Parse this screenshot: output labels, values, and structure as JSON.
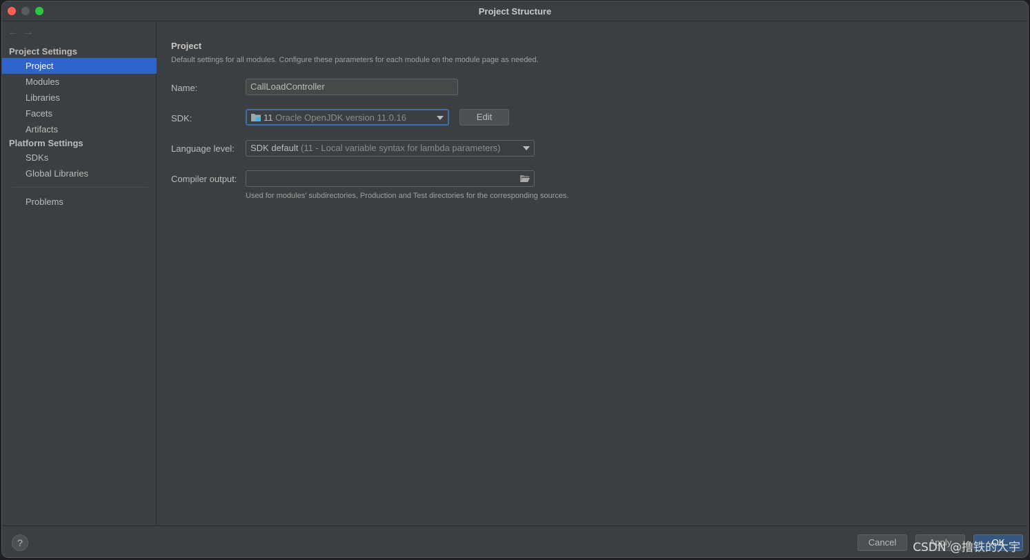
{
  "window": {
    "title": "Project Structure"
  },
  "nav": {
    "back": "←",
    "forward": "→"
  },
  "sidebar": {
    "project_settings_header": "Project Settings",
    "project_items": [
      {
        "label": "Project"
      },
      {
        "label": "Modules"
      },
      {
        "label": "Libraries"
      },
      {
        "label": "Facets"
      },
      {
        "label": "Artifacts"
      }
    ],
    "platform_settings_header": "Platform Settings",
    "platform_items": [
      {
        "label": "SDKs"
      },
      {
        "label": "Global Libraries"
      }
    ],
    "problems_label": "Problems",
    "selected": "Project"
  },
  "main": {
    "title": "Project",
    "description": "Default settings for all modules. Configure these parameters for each module on the module page as needed.",
    "name": {
      "label": "Name:",
      "value": "CallLoadController"
    },
    "sdk": {
      "label": "SDK:",
      "version_number": "11",
      "version_text": "Oracle OpenJDK version 11.0.16",
      "edit_label": "Edit"
    },
    "language_level": {
      "label": "Language level:",
      "value": "SDK default",
      "detail": "(11 - Local variable syntax for lambda parameters)"
    },
    "compiler_output": {
      "label": "Compiler output:",
      "value": "",
      "hint": "Used for modules' subdirectories, Production and Test directories for the corresponding sources."
    }
  },
  "footer": {
    "help_label": "?",
    "cancel_label": "Cancel",
    "apply_label": "Apply",
    "ok_label": "OK"
  },
  "watermark": "CSDN @撸铁的大宇",
  "colors": {
    "selection": "#2f65ca",
    "panel": "#3c3f41",
    "focus": "#3d6fa8"
  }
}
